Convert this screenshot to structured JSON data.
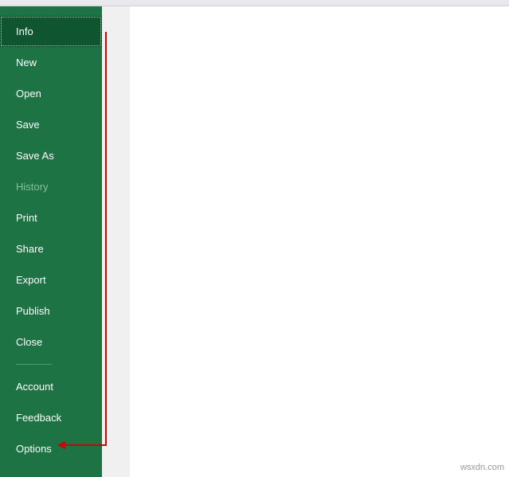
{
  "sidebar": {
    "items": [
      {
        "label": "Info",
        "selected": true,
        "disabled": false
      },
      {
        "label": "New",
        "selected": false,
        "disabled": false
      },
      {
        "label": "Open",
        "selected": false,
        "disabled": false
      },
      {
        "label": "Save",
        "selected": false,
        "disabled": false
      },
      {
        "label": "Save As",
        "selected": false,
        "disabled": false
      },
      {
        "label": "History",
        "selected": false,
        "disabled": true
      },
      {
        "label": "Print",
        "selected": false,
        "disabled": false
      },
      {
        "label": "Share",
        "selected": false,
        "disabled": false
      },
      {
        "label": "Export",
        "selected": false,
        "disabled": false
      },
      {
        "label": "Publish",
        "selected": false,
        "disabled": false
      },
      {
        "label": "Close",
        "selected": false,
        "disabled": false
      }
    ],
    "footer_items": [
      {
        "label": "Account"
      },
      {
        "label": "Feedback"
      },
      {
        "label": "Options"
      }
    ]
  },
  "watermark": "wsxdn.com",
  "colors": {
    "sidebar_bg": "#1e7344",
    "selected_bg": "#0e5530",
    "annotation": "#d40000"
  }
}
